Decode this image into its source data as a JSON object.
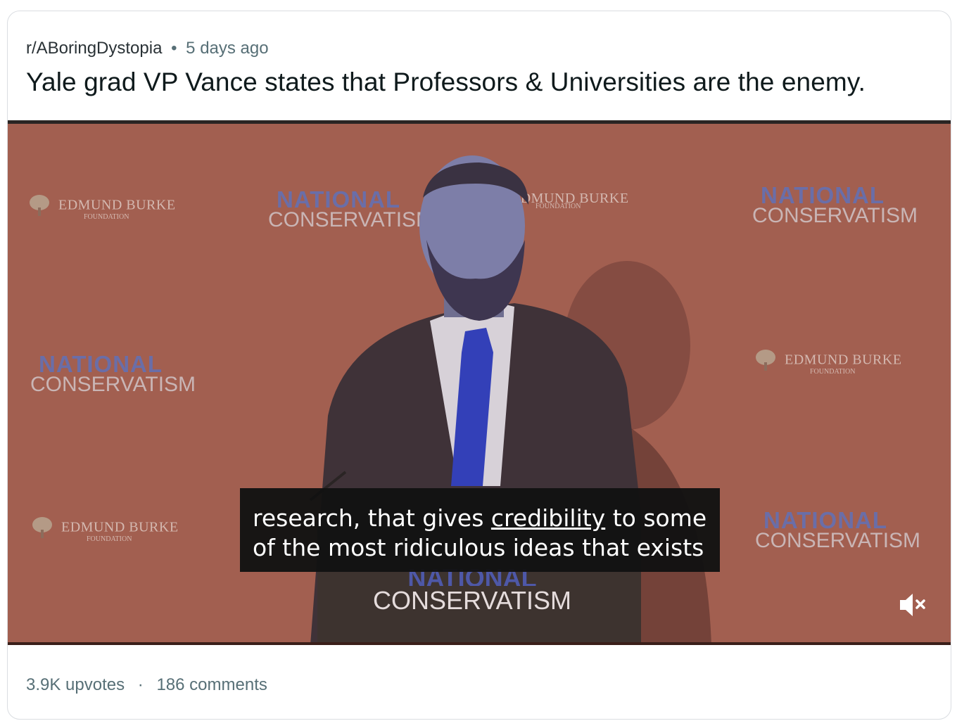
{
  "post": {
    "subreddit": "r/ABoringDystopia",
    "separator": "•",
    "time": "5 days ago",
    "title": "Yale grad VP Vance states that Professors & Universities are the enemy."
  },
  "video": {
    "backdrop_logos": {
      "national_line1": "NATIONAL",
      "national_line2": "CONSERVATISM",
      "burke_name": "EDMUND BURKE",
      "burke_sub": "FOUNDATION"
    },
    "caption": {
      "part1": "research, that gives ",
      "underlined": "credibility",
      "part2": " to some",
      "line2": "of the most ridiculous ideas that exists"
    },
    "podium": {
      "line1": "NATIONAL",
      "line2": "CONSERVATISM"
    },
    "mute_icon": "volume-muted-icon"
  },
  "footer": {
    "upvotes": "3.9K upvotes",
    "dot": "·",
    "comments": "186 comments"
  },
  "colors": {
    "backdrop": "#a25f50",
    "caption_bg": "#121212",
    "title_text": "#0f1a1c",
    "meta_text": "#576f76"
  }
}
